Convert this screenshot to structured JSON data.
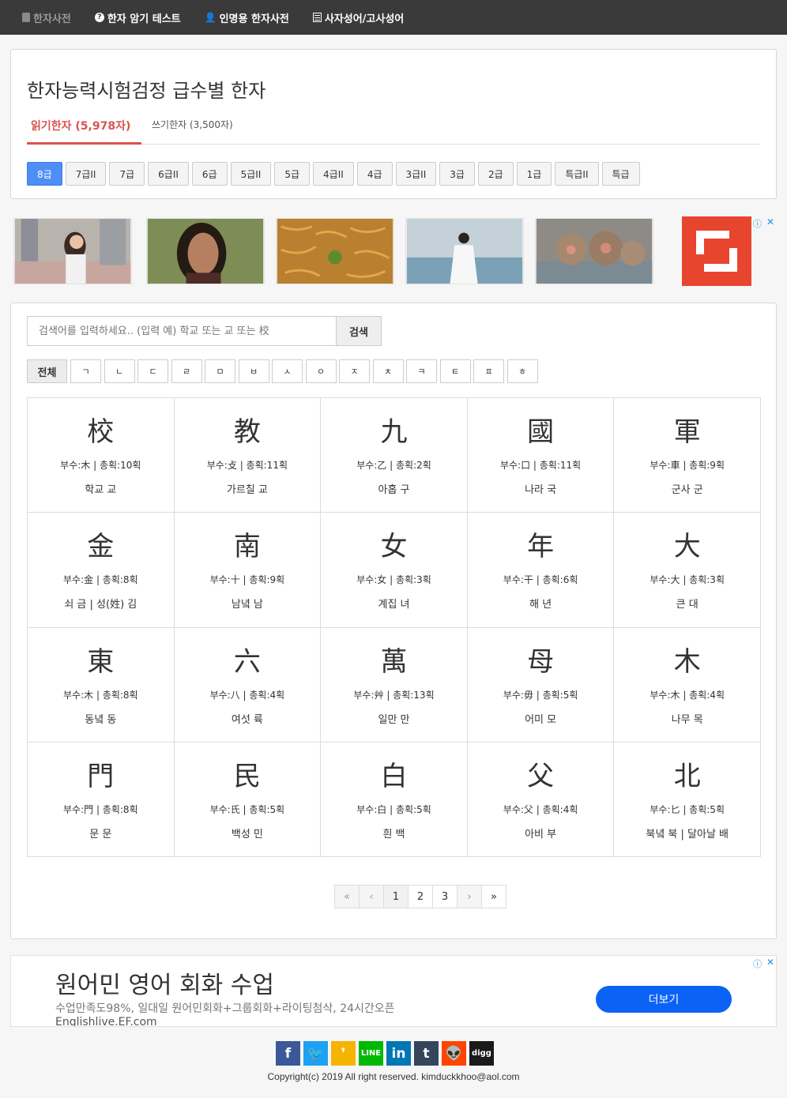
{
  "nav": [
    {
      "label": "한자사전",
      "icon": "book-icon"
    },
    {
      "label": "한자 암기 테스트",
      "icon": "question-icon"
    },
    {
      "label": "인명용 한자사전",
      "icon": "user-icon"
    },
    {
      "label": "사자성어/고사성어",
      "icon": "list-icon"
    }
  ],
  "page": {
    "title": "한자능력시험검정 급수별 한자",
    "tab_read": "읽기한자 (5,978자)",
    "tab_write": "쓰기한자 (3,500자)"
  },
  "grades": [
    "8급",
    "7급II",
    "7급",
    "6급II",
    "6급",
    "5급II",
    "5급",
    "4급II",
    "4급",
    "3급II",
    "3급",
    "2급",
    "1급",
    "특급II",
    "특급"
  ],
  "selected_grade": "8급",
  "ad_top": {
    "info": "ⓘ",
    "close": "✕"
  },
  "search": {
    "placeholder": "검색어를 입력하세요.. (입력 예) 학교 또는 교 또는 校",
    "button": "검색"
  },
  "initials": [
    "전체",
    "ㄱ",
    "ㄴ",
    "ㄷ",
    "ㄹ",
    "ㅁ",
    "ㅂ",
    "ㅅ",
    "ㅇ",
    "ㅈ",
    "ㅊ",
    "ㅋ",
    "ㅌ",
    "ㅍ",
    "ㅎ"
  ],
  "hanja": [
    {
      "char": "校",
      "meta": "부수:木 | 총획:10획",
      "meaning": "학교 교"
    },
    {
      "char": "教",
      "meta": "부수:攴 | 총획:11획",
      "meaning": "가르칠 교"
    },
    {
      "char": "九",
      "meta": "부수:乙 | 총획:2획",
      "meaning": "아홉 구"
    },
    {
      "char": "國",
      "meta": "부수:口 | 총획:11획",
      "meaning": "나라 국"
    },
    {
      "char": "軍",
      "meta": "부수:車 | 총획:9획",
      "meaning": "군사 군"
    },
    {
      "char": "金",
      "meta": "부수:金 | 총획:8획",
      "meaning": "쇠 금 | 성(姓) 김"
    },
    {
      "char": "南",
      "meta": "부수:十 | 총획:9획",
      "meaning": "남녘 남"
    },
    {
      "char": "女",
      "meta": "부수:女 | 총획:3획",
      "meaning": "계집 녀"
    },
    {
      "char": "年",
      "meta": "부수:干 | 총획:6획",
      "meaning": "해 년"
    },
    {
      "char": "大",
      "meta": "부수:大 | 총획:3획",
      "meaning": "큰 대"
    },
    {
      "char": "東",
      "meta": "부수:木 | 총획:8획",
      "meaning": "동녘 동"
    },
    {
      "char": "六",
      "meta": "부수:八 | 총획:4획",
      "meaning": "여섯 륙"
    },
    {
      "char": "萬",
      "meta": "부수:艸 | 총획:13획",
      "meaning": "일만 만"
    },
    {
      "char": "母",
      "meta": "부수:毋 | 총획:5획",
      "meaning": "어미 모"
    },
    {
      "char": "木",
      "meta": "부수:木 | 총획:4획",
      "meaning": "나무 목"
    },
    {
      "char": "門",
      "meta": "부수:門 | 총획:8획",
      "meaning": "문 문"
    },
    {
      "char": "民",
      "meta": "부수:氏 | 총획:5획",
      "meaning": "백성 민"
    },
    {
      "char": "白",
      "meta": "부수:白 | 총획:5획",
      "meaning": "흰 백"
    },
    {
      "char": "父",
      "meta": "부수:父 | 총획:4획",
      "meaning": "아비 부"
    },
    {
      "char": "北",
      "meta": "부수:匕 | 총획:5획",
      "meaning": "북녘 북 | 달아날 배"
    }
  ],
  "pagination": {
    "first": "«",
    "prev": "‹",
    "pages": [
      "1",
      "2",
      "3"
    ],
    "next": "›",
    "last": "»",
    "current": "1"
  },
  "bottom_ad": {
    "title": "원어민 영어 회화 수업",
    "desc": "수업만족도98%, 일대일 원어민회화+그룹회화+라이팅첨삭, 24시간오픈",
    "url": "Englishlive.EF.com",
    "button": "더보기",
    "info": "ⓘ",
    "close": "✕"
  },
  "social": [
    {
      "name": "facebook-icon",
      "glyph": "f",
      "color": "#3b5998"
    },
    {
      "name": "twitter-icon",
      "glyph": "🐦",
      "color": "#1da1f2"
    },
    {
      "name": "kakaostory-icon",
      "glyph": "❜",
      "color": "#f4b400"
    },
    {
      "name": "line-icon",
      "glyph": "LINE",
      "color": "#00b900"
    },
    {
      "name": "linkedin-icon",
      "glyph": "in",
      "color": "#0077b5"
    },
    {
      "name": "tumblr-icon",
      "glyph": "t",
      "color": "#35465c"
    },
    {
      "name": "reddit-icon",
      "glyph": "👽",
      "color": "#ff4500"
    },
    {
      "name": "digg-icon",
      "glyph": "digg",
      "color": "#1a1a1a"
    }
  ],
  "footer": {
    "copyright": "Copyright(c) 2019 All right reserved. kimduckkhoo@aol.com"
  }
}
